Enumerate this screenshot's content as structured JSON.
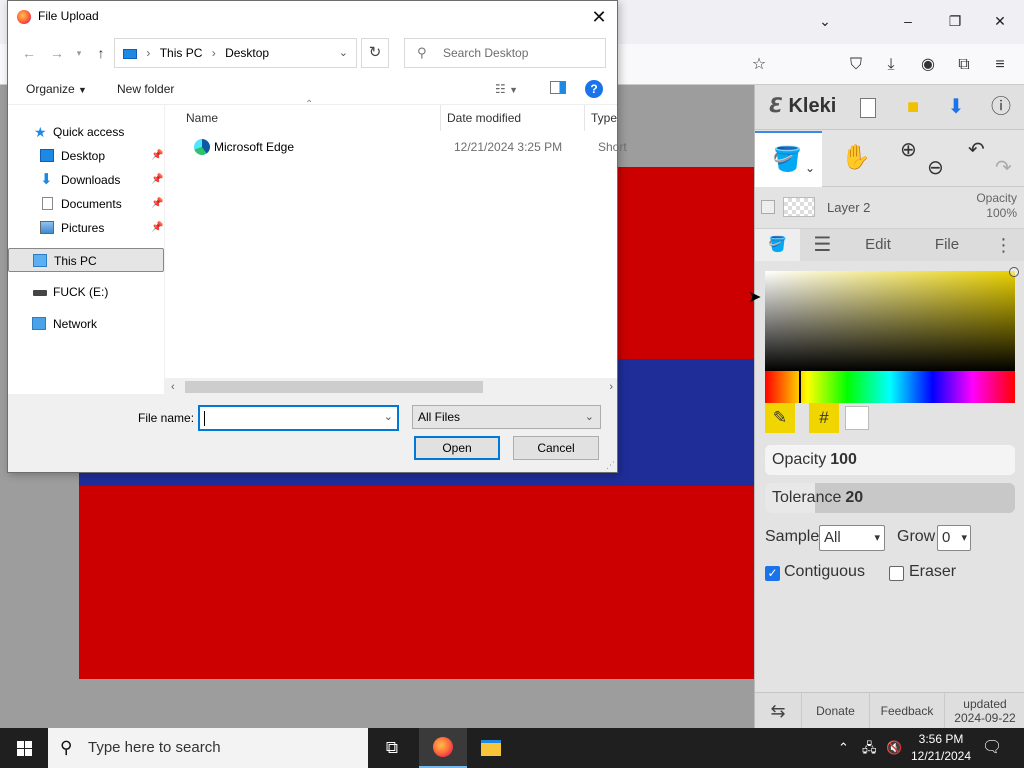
{
  "browser": {
    "controls": [
      "chevron-down",
      "minimize",
      "maximize",
      "close"
    ]
  },
  "kleki": {
    "logo": "Kleki",
    "layer": {
      "name": "Layer 2",
      "opacity_label": "Opacity",
      "opacity_value": "100%"
    },
    "tabs": [
      "Edit",
      "File"
    ],
    "color_hex_label": "#",
    "opacity": {
      "label": "Opacity",
      "value": "100"
    },
    "tolerance": {
      "label": "Tolerance",
      "value": "20"
    },
    "sample": {
      "label": "Sample",
      "value": "All"
    },
    "grow": {
      "label": "Grow",
      "value": "0"
    },
    "contiguous": {
      "label": "Contiguous",
      "checked": true
    },
    "eraser": {
      "label": "Eraser",
      "checked": false
    },
    "footer": {
      "donate": "Donate",
      "feedback": "Feedback",
      "updated_label": "updated",
      "updated_date": "2024-09-22"
    },
    "colors": {
      "accent": "#3a8ae6",
      "picker_yellow": "#f1d500"
    }
  },
  "canvas": {
    "colors": {
      "red": "#cc0000",
      "blue": "#1f2d99"
    }
  },
  "dialog": {
    "title": "File Upload",
    "breadcrumb": [
      "This PC",
      "Desktop"
    ],
    "search_placeholder": "Search Desktop",
    "toolbar": {
      "organize": "Organize",
      "new_folder": "New folder"
    },
    "nav": [
      {
        "label": "Quick access",
        "icon": "star-icon"
      },
      {
        "label": "Desktop",
        "icon": "desktop-icon",
        "pinned": true
      },
      {
        "label": "Downloads",
        "icon": "download-icon",
        "pinned": true
      },
      {
        "label": "Documents",
        "icon": "document-icon",
        "pinned": true
      },
      {
        "label": "Pictures",
        "icon": "pictures-icon",
        "pinned": true
      },
      {
        "label": "This PC",
        "icon": "pc-icon",
        "selected": true
      },
      {
        "label": "FUCK (E:)",
        "icon": "drive-icon"
      },
      {
        "label": "Network",
        "icon": "network-icon"
      }
    ],
    "columns": {
      "name": "Name",
      "date": "Date modified",
      "type": "Type"
    },
    "files": [
      {
        "name": "Microsoft Edge",
        "date": "12/21/2024 3:25 PM",
        "type": "Short"
      }
    ],
    "file_name_label": "File name:",
    "file_name_value": "",
    "file_type": "All Files",
    "open_label": "Open",
    "cancel_label": "Cancel"
  },
  "taskbar": {
    "search_placeholder": "Type here to search",
    "time": "3:56 PM",
    "date": "12/21/2024"
  }
}
